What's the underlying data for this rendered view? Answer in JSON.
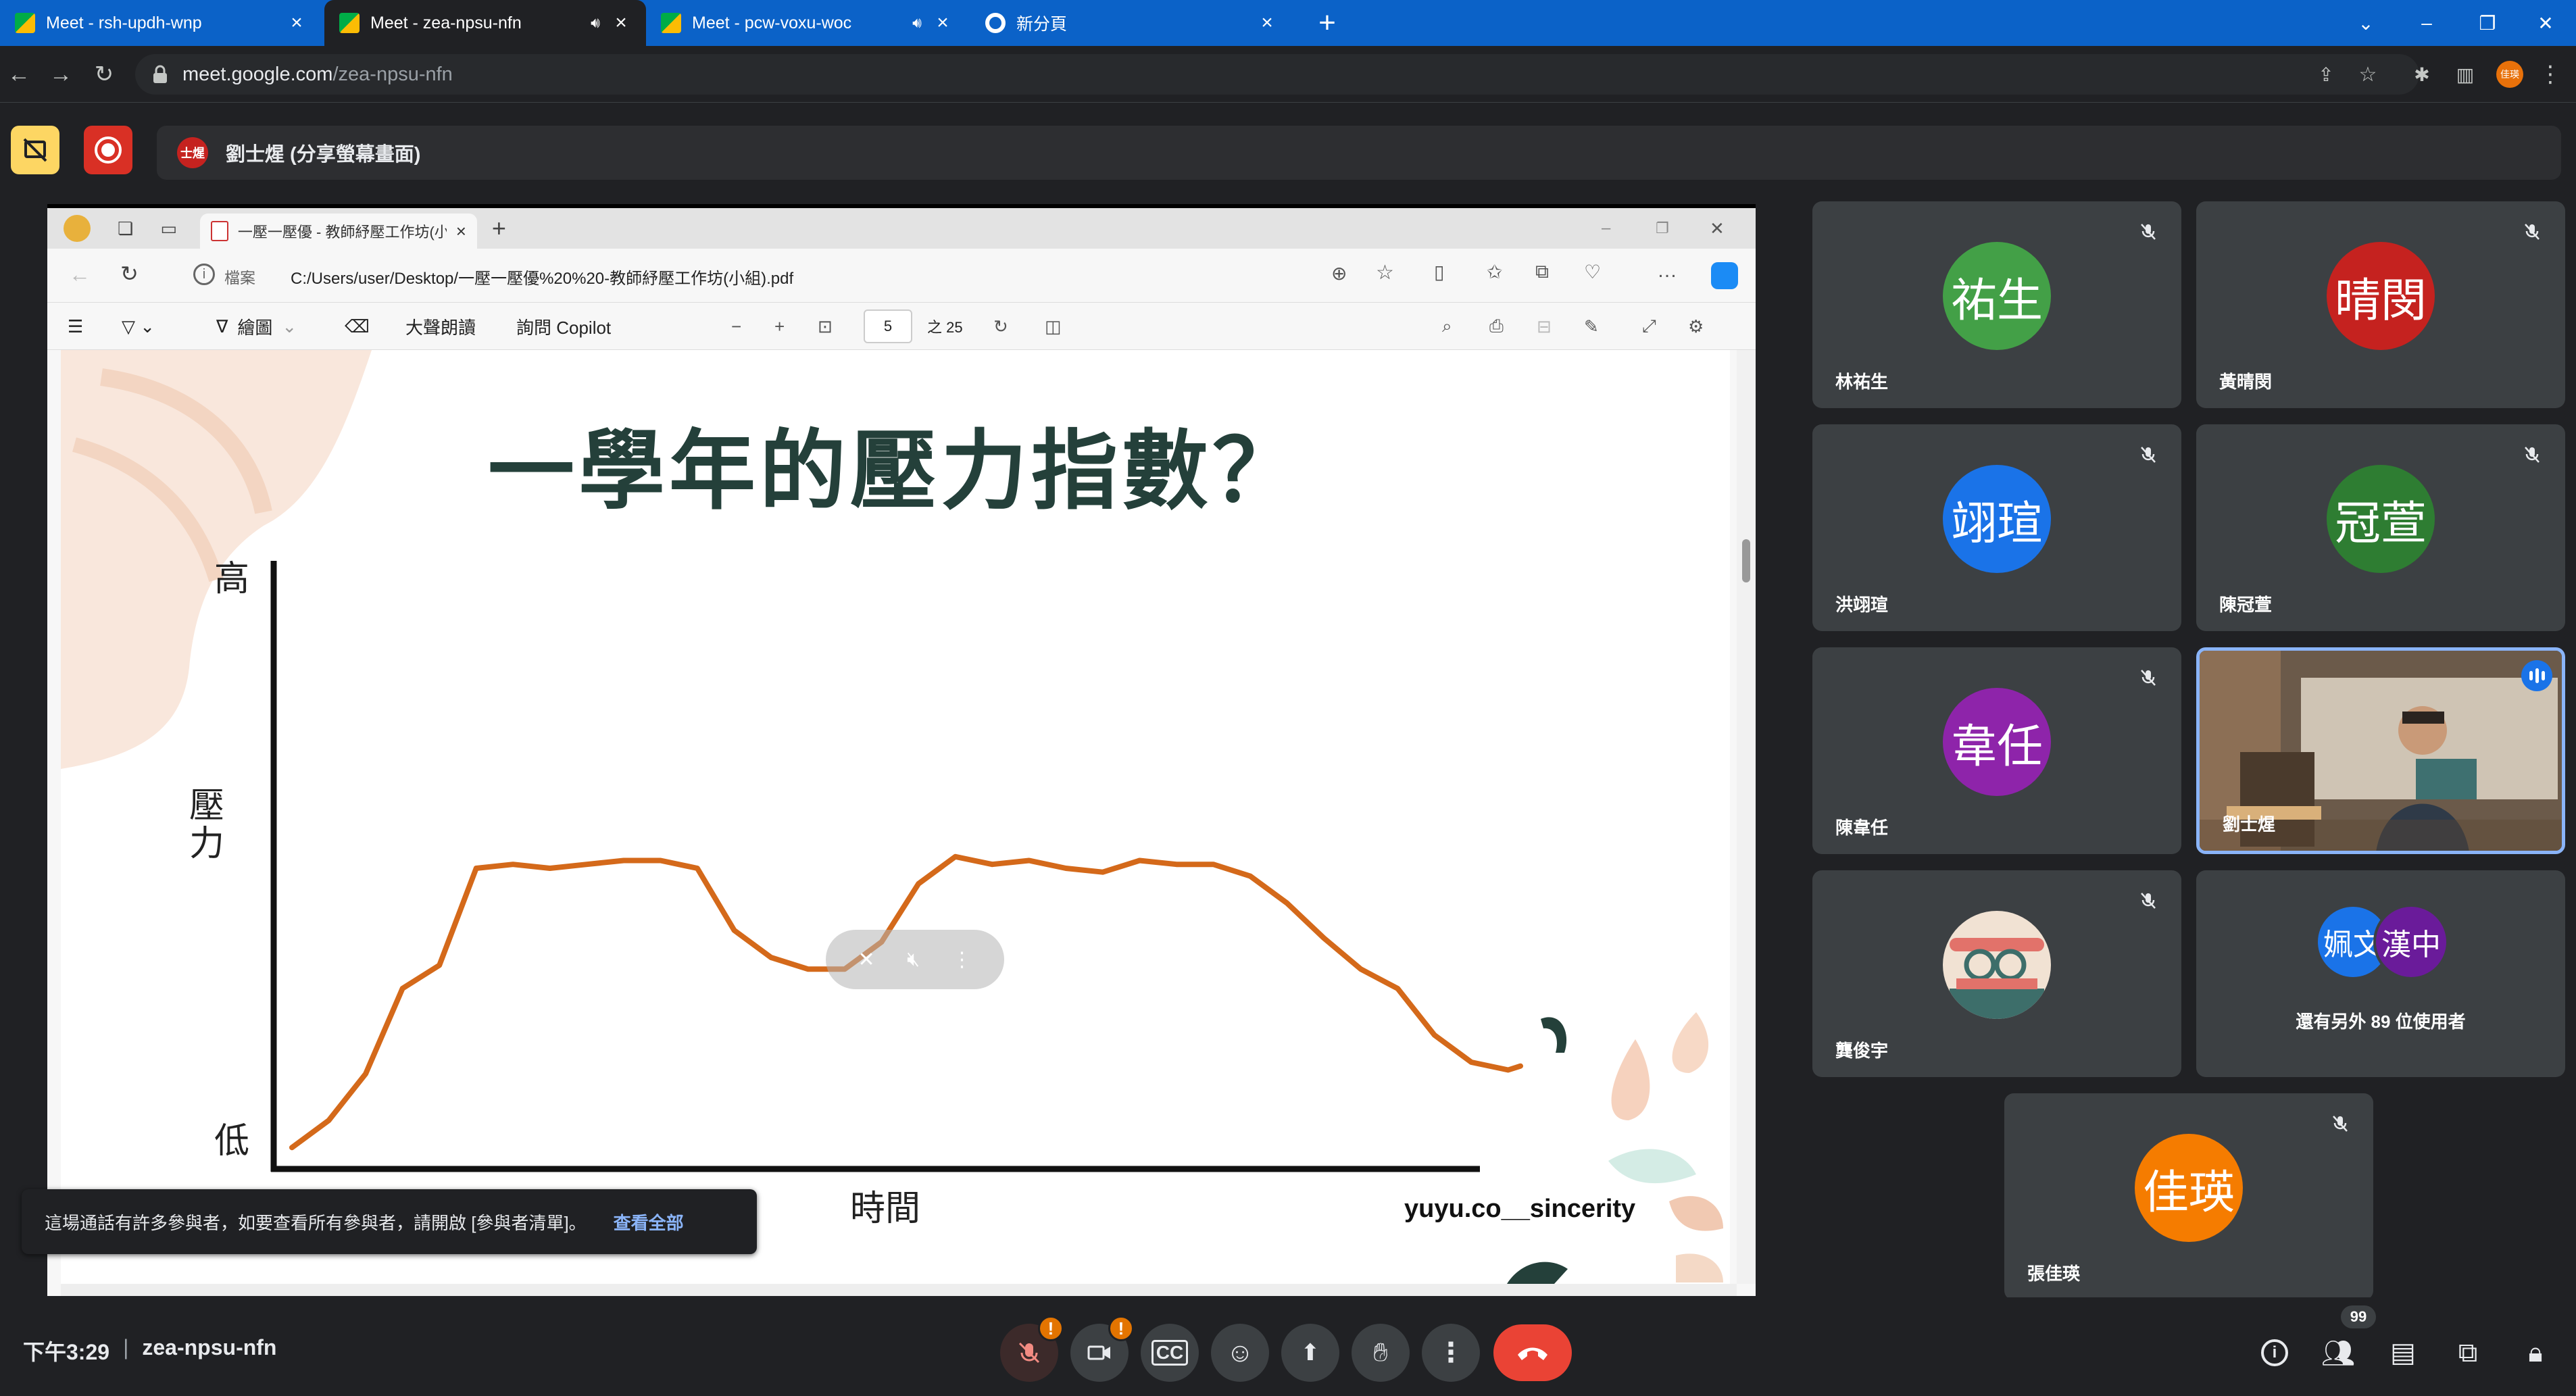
{
  "browser": {
    "tabs": [
      {
        "label": "Meet - rsh-updh-wnp",
        "active": false,
        "audio": false
      },
      {
        "label": "Meet - zea-npsu-nfn",
        "active": true,
        "audio": true
      },
      {
        "label": "Meet - pcw-voxu-woc",
        "active": false,
        "audio": true
      },
      {
        "label": "新分頁",
        "active": false,
        "audio": false
      }
    ],
    "url_host": "meet.google.com",
    "url_path": "/zea-npsu-nfn",
    "profile_initials": "佳瑛"
  },
  "meet": {
    "presenter_avatar": "士煋",
    "presenter_label": "劉士煋 (分享螢幕畫面)",
    "icons": [
      "no-share-icon",
      "record-icon"
    ],
    "time": "下午3:29",
    "separator": "|",
    "meeting_code": "zea-npsu-nfn",
    "participant_count_badge": "99",
    "toast": {
      "text": "這場通話有許多參與者，如要查看所有參與者，請開啟 [參與者清單]。",
      "link": "查看全部"
    }
  },
  "edge": {
    "tab_label": "一壓一壓優 - 教師紓壓工作坊(小組",
    "scheme_label": "檔案",
    "path": "C:/Users/user/Desktop/一壓一壓優%20%20-教師紓壓工作坊(小組).pdf",
    "toolbar": {
      "draw": "繪圖",
      "read_aloud": "大聲朗讀",
      "copilot": "詢問 Copilot",
      "page": "5",
      "of_pages": "之 25"
    }
  },
  "slide": {
    "title": "一學年的壓力指數？",
    "y_high": "高",
    "y_mid_1": "壓",
    "y_mid_2": "力",
    "y_low": "低",
    "x_label": "時間",
    "credit": "yuyu.co__sincerity",
    "line_color": "#d4691a"
  },
  "chart_data": {
    "type": "line",
    "title": "一學年的壓力指數？",
    "xlabel": "時間",
    "ylabel": "壓力",
    "y_tick_labels": [
      "低",
      "高"
    ],
    "x": [
      0,
      3,
      6,
      9,
      12,
      15,
      18,
      21,
      24,
      27,
      30,
      33,
      36,
      39,
      42,
      45,
      48,
      51,
      54,
      57,
      60,
      63,
      66,
      69,
      72,
      75,
      78,
      81,
      84,
      87,
      90,
      93,
      96,
      99,
      100
    ],
    "values": [
      1,
      8,
      20,
      42,
      48,
      73,
      74,
      73,
      74,
      75,
      75,
      73,
      57,
      50,
      47,
      47,
      54,
      69,
      76,
      74,
      75,
      73,
      72,
      75,
      74,
      74,
      71,
      64,
      55,
      47,
      42,
      30,
      23,
      21,
      22
    ],
    "ylim": [
      0,
      100
    ],
    "grid": false
  },
  "participants": [
    {
      "name": "林祐生",
      "avatar": "祐生",
      "color": "#43a047",
      "muted": true
    },
    {
      "name": "黃晴閔",
      "avatar": "晴閔",
      "color": "#c5221f",
      "muted": true
    },
    {
      "name": "洪翊瑄",
      "avatar": "翊瑄",
      "color": "#1a73e8",
      "muted": true
    },
    {
      "name": "陳冠萱",
      "avatar": "冠萱",
      "color": "#2e7d32",
      "muted": true
    },
    {
      "name": "陳韋任",
      "avatar": "韋任",
      "color": "#8e24aa",
      "muted": true
    },
    {
      "name": "劉士煋",
      "avatar": "",
      "color": "#8ab4f8",
      "muted": false,
      "speaking": true
    },
    {
      "name": "龔俊宇",
      "avatar": "",
      "color": "#f1e2d3",
      "muted": true
    },
    {
      "name": "張佳瑛",
      "avatar": "佳瑛",
      "color": "#f57c00",
      "muted": true
    }
  ],
  "others_tile": {
    "avatars": [
      "姵文",
      "漢中"
    ],
    "text": "還有另外 89 位使用者"
  }
}
